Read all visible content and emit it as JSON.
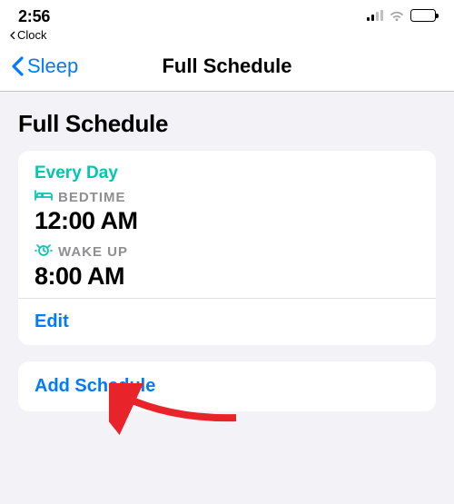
{
  "status": {
    "time": "2:56",
    "breadcrumb_app": "Clock"
  },
  "nav": {
    "back_label": "Sleep",
    "title": "Full Schedule"
  },
  "section": {
    "heading": "Full Schedule"
  },
  "schedule": {
    "days_label": "Every Day",
    "bedtime_label": "BEDTIME",
    "bedtime_value": "12:00 AM",
    "wakeup_label": "WAKE UP",
    "wakeup_value": "8:00 AM",
    "edit_label": "Edit"
  },
  "add": {
    "label": "Add Schedule"
  },
  "colors": {
    "accent_teal": "#00c7ae",
    "ios_blue": "#007aff"
  }
}
